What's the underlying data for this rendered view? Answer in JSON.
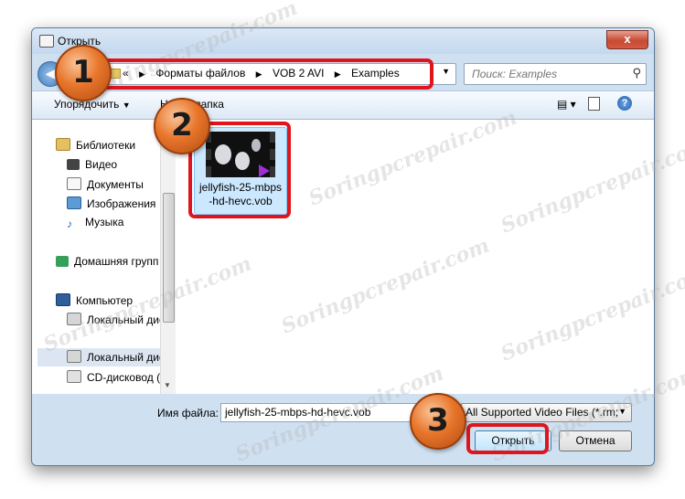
{
  "window": {
    "title": "Открыть",
    "close_label": "x"
  },
  "address": {
    "crumb_prefix": "«",
    "crumbs": [
      "Форматы файлов",
      "VOB 2 AVI",
      "Examples"
    ]
  },
  "search": {
    "placeholder": "Поиск: Examples"
  },
  "toolbar": {
    "organize_label": "Упорядочить",
    "new_folder_label": "Новая папка"
  },
  "nav_pane": {
    "items": [
      {
        "label": "Библиотеки",
        "icon": "libraries-icon"
      },
      {
        "label": "Видео",
        "icon": "video-icon"
      },
      {
        "label": "Документы",
        "icon": "documents-icon"
      },
      {
        "label": "Изображения",
        "icon": "images-icon"
      },
      {
        "label": "Музыка",
        "icon": "music-icon"
      },
      {
        "label": "Домашняя групп",
        "icon": "homegroup-icon"
      },
      {
        "label": "Компьютер",
        "icon": "computer-icon"
      },
      {
        "label": "Локальный дис",
        "icon": "local-disk-icon"
      },
      {
        "label": "Локальный дис",
        "icon": "local-disk-icon",
        "selected": true
      },
      {
        "label": "CD-дисковод (H",
        "icon": "cd-drive-icon"
      }
    ]
  },
  "files": [
    {
      "name_line1": "jellyfish-25-mbps",
      "name_line2": "-hd-hevc.vob"
    }
  ],
  "bottom": {
    "filename_label": "Имя файла:",
    "filename_value": "jellyfish-25-mbps-hd-hevc.vob",
    "filter_value": "All Supported Video Files (*.rm;",
    "open_label": "Открыть",
    "cancel_label": "Отмена"
  },
  "annotations": {
    "badge1": "1",
    "badge2": "2",
    "badge3": "3",
    "accent_color": "#e0141d",
    "badge_color": "#e8762b"
  },
  "watermark": {
    "text": "Soringpcrepair.com"
  }
}
